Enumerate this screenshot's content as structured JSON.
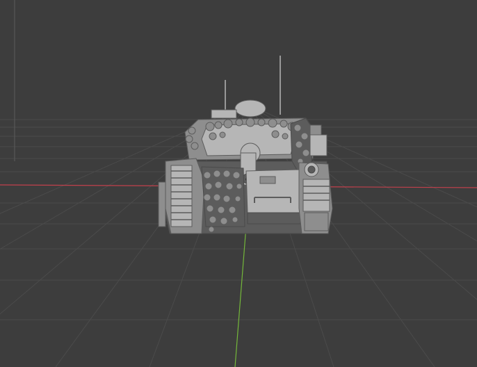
{
  "viewport": {
    "background_color": "#3d3d3d",
    "grid_color": "#4b4b4b",
    "x_axis_color": "#c2404c",
    "y_axis_color": "#74b83a",
    "model_color": "#8e8e8e",
    "model_shadow_color": "#5c5c5c",
    "model_highlight_color": "#b6b6b6"
  }
}
